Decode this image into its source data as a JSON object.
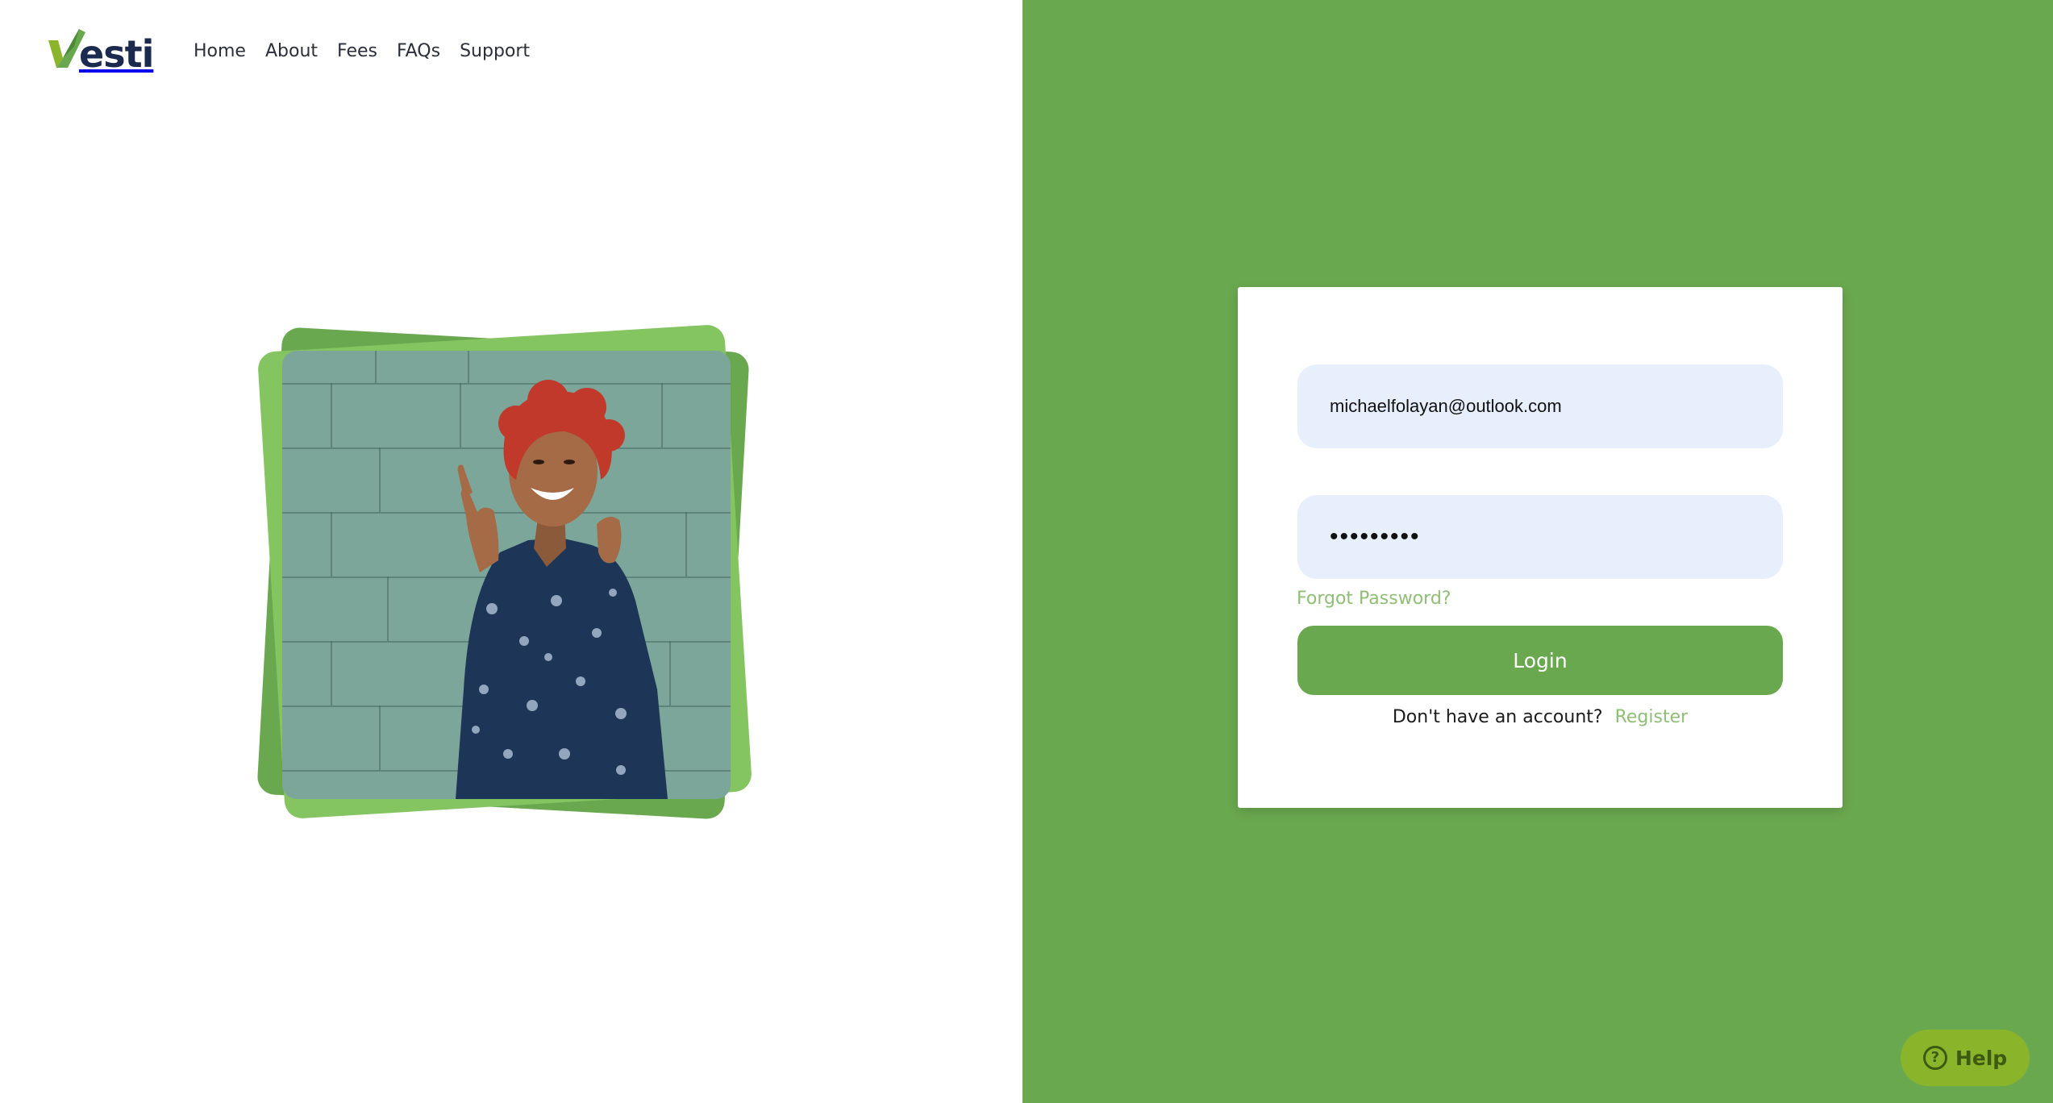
{
  "brand": {
    "logo_text": "esti",
    "logo_alt": "Vesti"
  },
  "nav": {
    "items": [
      "Home",
      "About",
      "Fees",
      "FAQs",
      "Support"
    ]
  },
  "login": {
    "email_value": "michaelfolayan@outlook.com",
    "password_value": "•••••••••",
    "forgot_label": "Forgot Password?",
    "login_label": "Login",
    "register_prompt": "Don't have an account?",
    "register_label": "Register"
  },
  "help": {
    "label": "Help"
  },
  "colors": {
    "accent": "#6aa84f",
    "accent_light": "#84c461",
    "link": "#8fbe76",
    "input_bg": "#e8effc",
    "help_bg": "#8ab52a",
    "logo_text": "#1b2a4e"
  },
  "icons": {
    "logo_mark": "vesti-v-logo-icon",
    "help": "question-circle-icon"
  }
}
